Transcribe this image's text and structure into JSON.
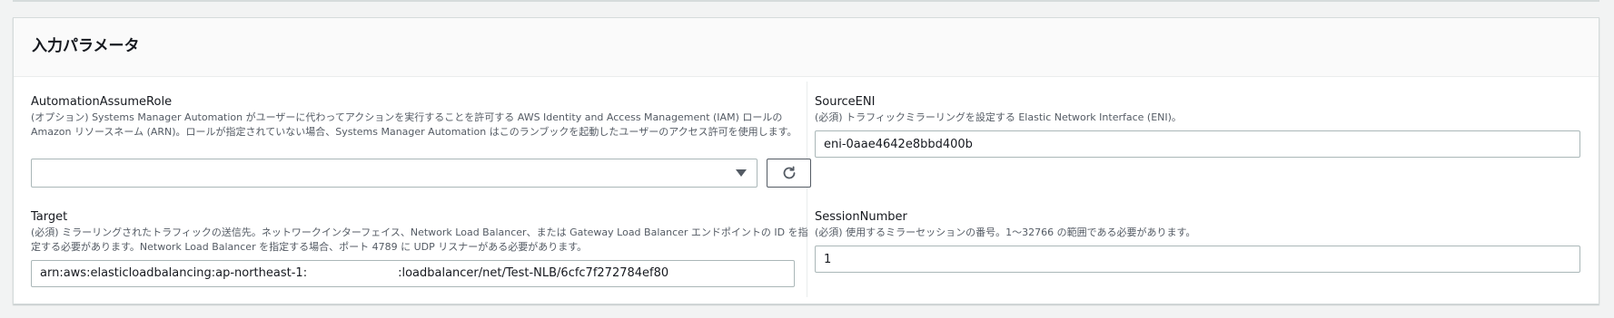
{
  "panel": {
    "title": "入力パラメータ"
  },
  "fields": {
    "automation_assume_role": {
      "label": "AutomationAssumeRole",
      "description": "(オプション) Systems Manager Automation がユーザーに代わってアクションを実行することを許可する AWS Identity and Access Management (IAM) ロールの Amazon リソースネーム (ARN)。ロールが指定されていない場合、Systems Manager Automation はこのランブックを起動したユーザーのアクセス許可を使用します。",
      "value": "",
      "refresh_icon": "refresh-icon",
      "caret_icon": "caret-down-icon"
    },
    "source_eni": {
      "label": "SourceENI",
      "description": "(必須) トラフィックミラーリングを設定する Elastic Network Interface (ENI)。",
      "value": "eni-0aae4642e8bbd400b"
    },
    "target": {
      "label": "Target",
      "description": "(必須) ミラーリングされたトラフィックの送信先。ネットワークインターフェイス、Network Load Balancer、または Gateway Load Balancer エンドポイントの ID を指定する必要があります。Network Load Balancer を指定する場合、ポート 4789 に UDP リスナーがある必要があります。",
      "value_prefix": "arn:aws:elasticloadbalancing:ap-northeast-1:",
      "value_suffix": ":loadbalancer/net/Test-NLB/6cfc7f272784ef80"
    },
    "session_number": {
      "label": "SessionNumber",
      "description": "(必須) 使用するミラーセッションの番号。1〜32766 の範囲である必要があります。",
      "value": "1"
    }
  }
}
